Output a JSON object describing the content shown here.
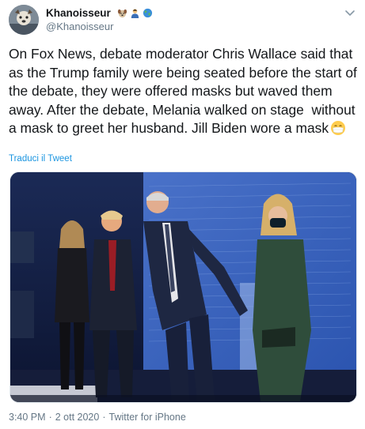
{
  "author": {
    "display_name": "Khanoisseur",
    "handle": "@Khanoisseur",
    "badges": [
      "dog-emoji",
      "person-emoji",
      "globe-emoji"
    ]
  },
  "tweet": {
    "text": "On Fox News, debate moderator Chris Wallace said that as the Trump family were being seated before the start of the debate, they were offered masks but waved them away. After the debate, Melania walked on stage  without a mask to greet her husband. Jill Biden wore a mask",
    "trailing_emoji": "face-with-medical-mask-emoji",
    "translate_label": "Traduci il Tweet"
  },
  "meta": {
    "time": "3:40 PM",
    "separator": "·",
    "date": "2 ott 2020",
    "source": "Twitter for iPhone"
  },
  "colors": {
    "link": "#1b95e0",
    "secondary_text": "#657786",
    "primary_text": "#14171a"
  }
}
